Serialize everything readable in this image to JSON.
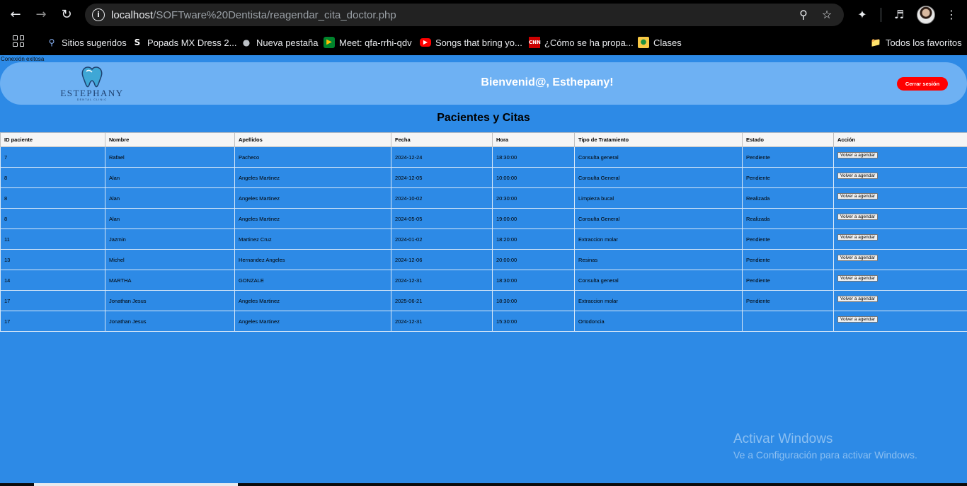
{
  "browser": {
    "url_host": "localhost",
    "url_path": "/SOFTware%20Dentista/reagendar_cita_doctor.php",
    "bookmarks": [
      {
        "label": "Sitios sugeridos",
        "icon": "search-icon"
      },
      {
        "label": "Popads MX Dress 2...",
        "icon": "s-favicon"
      },
      {
        "label": "Nueva pestaña",
        "icon": "globe-icon"
      },
      {
        "label": "Meet: qfa-rrhi-qdv",
        "icon": "meet-icon"
      },
      {
        "label": "Songs that bring yo...",
        "icon": "youtube-icon"
      },
      {
        "label": "¿Cómo se ha propa...",
        "icon": "cnn-icon"
      },
      {
        "label": "Clases",
        "icon": "classroom-icon"
      }
    ],
    "all_bookmarks": "Todos los favoritos"
  },
  "page": {
    "status": "Conexión exitosa",
    "logo_name": "ESTEPHANY",
    "logo_sub": "DENTAL CLINIC",
    "welcome": "Bienvenid@, Esthepany!",
    "logout": "Cerrar sesión",
    "title": "Pacientes y Citas"
  },
  "table": {
    "headers": [
      "ID paciente",
      "Nombre",
      "Apellidos",
      "Fecha",
      "Hora",
      "Tipo de Tratamiento",
      "Estado",
      "Acción"
    ],
    "action_label": "Volver a agendar",
    "rows": [
      [
        "7",
        "Rafael",
        "Pacheco",
        "2024-12-24",
        "18:30:00",
        "Consulta general",
        "Pendiente"
      ],
      [
        "8",
        "Alan",
        "Angeles Martinez",
        "2024-12-05",
        "10:00:00",
        "Consulta General",
        "Pendiente"
      ],
      [
        "8",
        "Alan",
        "Angeles Martinez",
        "2024-10-02",
        "20:30:00",
        "Limpieza bucal",
        "Realizada"
      ],
      [
        "8",
        "Alan",
        "Angeles Martinez",
        "2024-05-05",
        "19:00:00",
        "Consulta General",
        "Realizada"
      ],
      [
        "11",
        "Jazmin",
        "Martinez Cruz",
        "2024-01-02",
        "18:20:00",
        "Extraccion molar",
        "Pendiente"
      ],
      [
        "13",
        "Michel",
        "Hernandez Angeles",
        "2024-12-06",
        "20:00:00",
        "Resinas",
        "Pendiente"
      ],
      [
        "14",
        "MARTHA",
        "GONZALE",
        "2024-12-31",
        "18:30:00",
        "Consulta general",
        "Pendiente"
      ],
      [
        "17",
        "Jonathan Jesus",
        "Angeles Martinez",
        "2025-06-21",
        "18:30:00",
        "Extraccion molar",
        "Pendiente"
      ],
      [
        "17",
        "Jonathan Jesus",
        "Angeles Martinez",
        "2024-12-31",
        "15:30:00",
        "Ortodoncia",
        ""
      ]
    ]
  },
  "watermark": {
    "line1": "Activar Windows",
    "line2": "Ve a Configuración para activar Windows."
  },
  "colors": {
    "page_bg": "#2d8ae6",
    "header_bg": "#6eb1f3",
    "logout_bg": "#ff0000"
  }
}
